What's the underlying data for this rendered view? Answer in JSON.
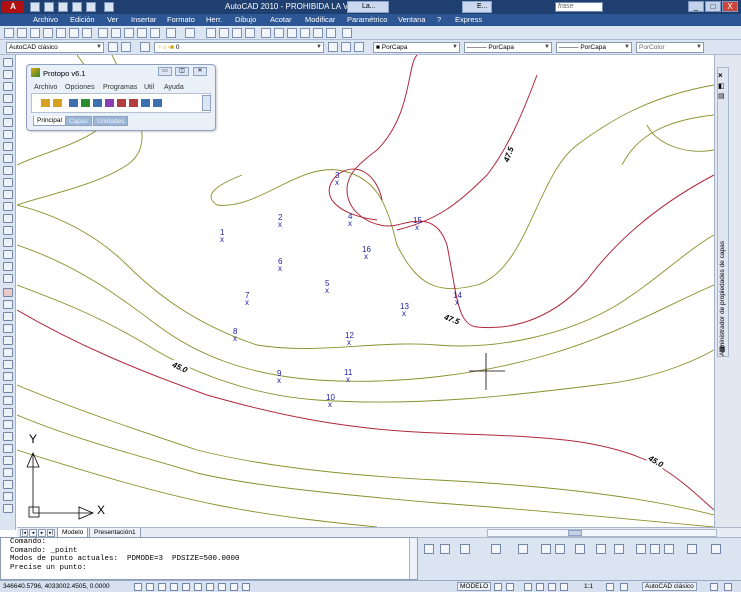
{
  "window": {
    "title": "AutoCAD 2010 - PROHIBIDA LA VENTA",
    "app_logo": "A",
    "taskbar_items": [
      "La...",
      "E..."
    ],
    "search_placeholder": "frase",
    "controls": [
      "_",
      "□",
      "X"
    ]
  },
  "menubar": {
    "items": [
      "Archivo",
      "Edición",
      "Ver",
      "Insertar",
      "Formato",
      "Herr.",
      "Dibujo",
      "Acotar",
      "Modificar",
      "Paramétrico",
      "Ventana",
      "?",
      "Express"
    ]
  },
  "toolbar2": {
    "workspace": "AutoCAD clásico",
    "layer": "0",
    "color": "PorCapa",
    "linetype": "PorCapa",
    "lineweight": "PorCapa",
    "plotstyle": "PorColor"
  },
  "protopo": {
    "title": "Protopo v6.1",
    "menu": [
      "Archivo",
      "Opciones",
      "Programas",
      "Util",
      "Ayuda"
    ],
    "tabs": [
      "Principal",
      "Capas",
      "Unidades"
    ]
  },
  "drawing": {
    "points": [
      {
        "id": "1"
      },
      {
        "id": "2"
      },
      {
        "id": "3"
      },
      {
        "id": "4"
      },
      {
        "id": "5"
      },
      {
        "id": "6"
      },
      {
        "id": "7"
      },
      {
        "id": "8"
      },
      {
        "id": "9"
      },
      {
        "id": "10"
      },
      {
        "id": "11"
      },
      {
        "id": "12"
      },
      {
        "id": "13"
      },
      {
        "id": "14"
      },
      {
        "id": "15"
      },
      {
        "id": "16"
      }
    ],
    "point_marker": "x",
    "contour_labels": [
      "47.5",
      "47.5",
      "45.0",
      "45.0"
    ],
    "contour_colors": {
      "major": "#b0283a",
      "minor": "#8a8f2a"
    },
    "ucs_x_label": "X",
    "ucs_y_label": "Y"
  },
  "right_palette": {
    "label": "Administrador de propiedades de capas"
  },
  "tabs": {
    "items": [
      "Modelo",
      "Presentación1"
    ]
  },
  "command": {
    "lines": [
      "Comando:",
      "Comando: _point",
      "Modos de punto actuales:  PDMODE=3  PDSIZE=500.0000",
      "Precise un punto:"
    ]
  },
  "status": {
    "coords": "346640.5796, 4033002.4505, 0.0000",
    "model": "MODELO",
    "scale": "1:1",
    "workspace": "AutoCAD clásico"
  }
}
